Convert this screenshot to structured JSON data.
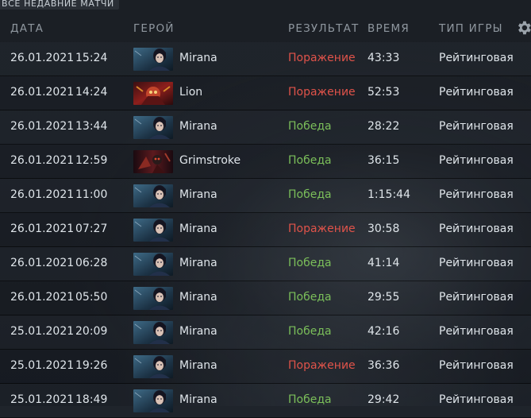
{
  "top_tab": {
    "label": "ВСЕ НЕДАВНИЕ МАТЧИ"
  },
  "header": {
    "date": "ДАТА",
    "hero": "ГЕРОЙ",
    "result": "РЕЗУЛЬТАТ",
    "duration": "ВРЕМЯ",
    "game_type": "ТИП ИГРЫ",
    "settings_icon": "gear-icon"
  },
  "colors": {
    "loss": "#e0534a",
    "win": "#7bbf5a",
    "header_text": "#8f979f"
  },
  "matches": [
    {
      "date": "26.01.2021",
      "time": "15:24",
      "hero": "Mirana",
      "result": "Поражение",
      "outcome": "loss",
      "duration": "43:33",
      "game_type": "Рейтинговая"
    },
    {
      "date": "26.01.2021",
      "time": "14:24",
      "hero": "Lion",
      "result": "Поражение",
      "outcome": "loss",
      "duration": "52:53",
      "game_type": "Рейтинговая"
    },
    {
      "date": "26.01.2021",
      "time": "13:44",
      "hero": "Mirana",
      "result": "Победа",
      "outcome": "win",
      "duration": "28:22",
      "game_type": "Рейтинговая"
    },
    {
      "date": "26.01.2021",
      "time": "12:59",
      "hero": "Grimstroke",
      "result": "Победа",
      "outcome": "win",
      "duration": "36:15",
      "game_type": "Рейтинговая"
    },
    {
      "date": "26.01.2021",
      "time": "11:00",
      "hero": "Mirana",
      "result": "Победа",
      "outcome": "win",
      "duration": "1:15:44",
      "game_type": "Рейтинговая"
    },
    {
      "date": "26.01.2021",
      "time": "07:27",
      "hero": "Mirana",
      "result": "Поражение",
      "outcome": "loss",
      "duration": "30:58",
      "game_type": "Рейтинговая"
    },
    {
      "date": "26.01.2021",
      "time": "06:28",
      "hero": "Mirana",
      "result": "Победа",
      "outcome": "win",
      "duration": "41:14",
      "game_type": "Рейтинговая"
    },
    {
      "date": "26.01.2021",
      "time": "05:50",
      "hero": "Mirana",
      "result": "Победа",
      "outcome": "win",
      "duration": "29:55",
      "game_type": "Рейтинговая"
    },
    {
      "date": "25.01.2021",
      "time": "20:09",
      "hero": "Mirana",
      "result": "Победа",
      "outcome": "win",
      "duration": "42:16",
      "game_type": "Рейтинговая"
    },
    {
      "date": "25.01.2021",
      "time": "19:26",
      "hero": "Mirana",
      "result": "Поражение",
      "outcome": "loss",
      "duration": "36:36",
      "game_type": "Рейтинговая"
    },
    {
      "date": "25.01.2021",
      "time": "18:49",
      "hero": "Mirana",
      "result": "Победа",
      "outcome": "win",
      "duration": "29:42",
      "game_type": "Рейтинговая"
    }
  ]
}
